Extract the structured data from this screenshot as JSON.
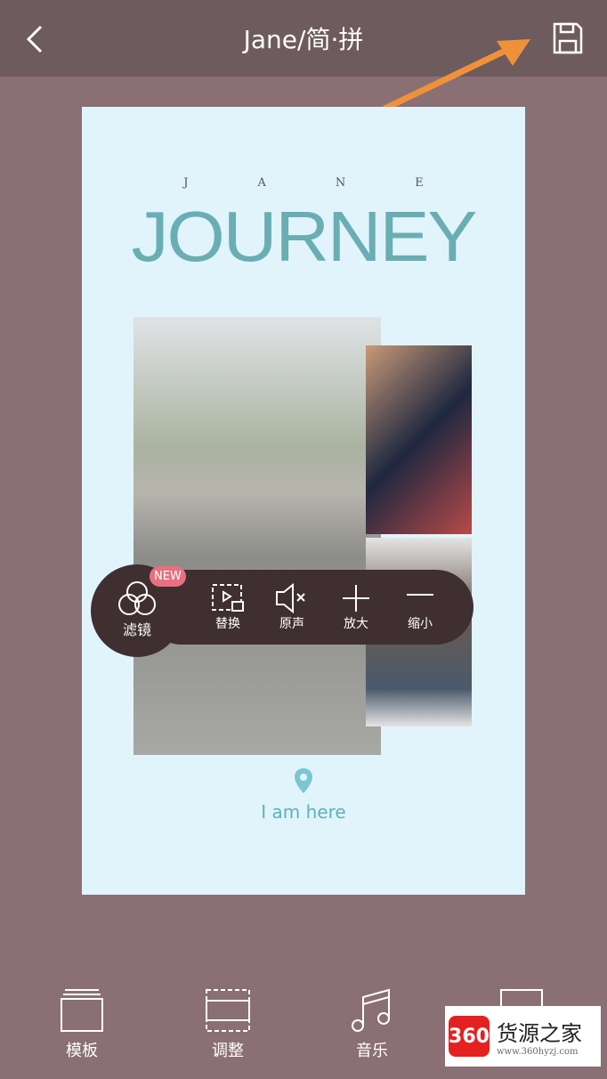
{
  "header": {
    "title": "Jane/简·拼",
    "back_icon": "chevron-left-icon",
    "save_icon": "save-icon"
  },
  "canvas": {
    "jane": [
      "J",
      "A",
      "N",
      "E"
    ],
    "journey": "JOURNEY",
    "location": "I am here"
  },
  "toolbar": {
    "filter": "滤镜",
    "new_badge": "NEW",
    "replace": "替换",
    "original_sound": "原声",
    "zoom_in": "放大",
    "zoom_out": "缩小"
  },
  "bottom": {
    "template": "模板",
    "adjust": "调整",
    "music": "音乐"
  },
  "watermark": {
    "logo": "360",
    "name": "货源之家",
    "url": "www.360hyzj.com"
  },
  "colors": {
    "arrow": "#f0913a",
    "canvas": "#e1f4fb",
    "accent": "#6aaeb4",
    "badge": "#e8707f"
  }
}
